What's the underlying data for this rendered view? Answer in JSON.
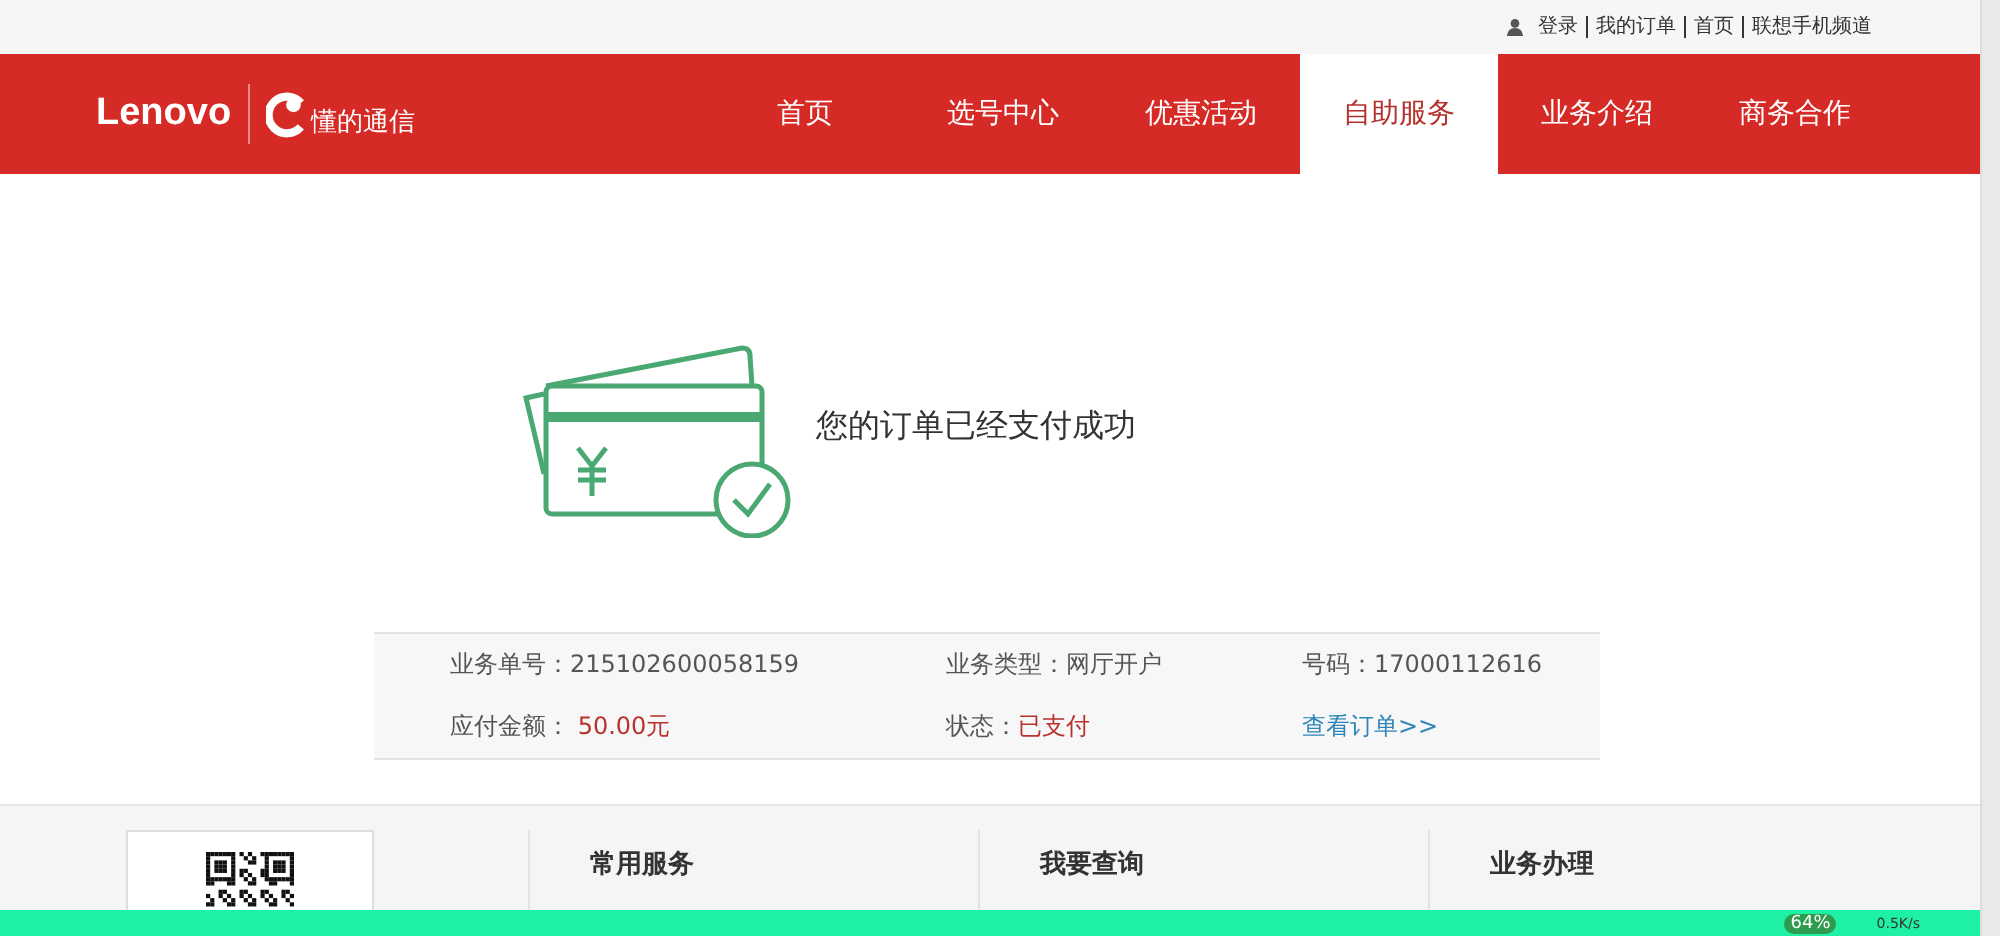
{
  "top_links": [
    "登录",
    "我的订单",
    "首页",
    "联想手机频道"
  ],
  "logo": {
    "brand": "Lenovo",
    "sub": "懂的通信"
  },
  "nav": [
    {
      "label": "首页",
      "selected": false
    },
    {
      "label": "选号中心",
      "selected": false
    },
    {
      "label": "优惠活动",
      "selected": false
    },
    {
      "label": "自助服务",
      "selected": true
    },
    {
      "label": "业务介绍",
      "selected": false
    },
    {
      "label": "商务合作",
      "selected": false
    }
  ],
  "message": "您的订单已经支付成功",
  "order_info": [
    {
      "kind": "plain",
      "label": "业务单号：",
      "value": "215102600058159"
    },
    {
      "kind": "plain",
      "label": "业务类型：",
      "value": "网厅开户"
    },
    {
      "kind": "plain",
      "label": "号码：",
      "value": "17000112616"
    },
    {
      "kind": "highlight",
      "label": "应付金额： ",
      "value": "50.00元"
    },
    {
      "kind": "highlight",
      "label": "状态：",
      "value": "已支付"
    },
    {
      "kind": "link",
      "value": "查看订单>>"
    }
  ],
  "footer_columns": [
    "常用服务",
    "我要查询",
    "业务办理"
  ],
  "overlay": {
    "percent": "64%",
    "speed": "0.5K/s"
  }
}
